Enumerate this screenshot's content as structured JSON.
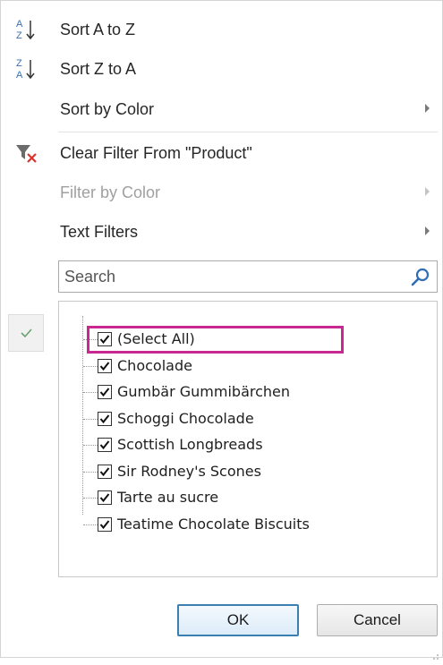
{
  "menu": {
    "sort_az": {
      "label": "Sort A to Z",
      "icon": "sort-ascending-icon"
    },
    "sort_za": {
      "label": "Sort Z to A",
      "icon": "sort-descending-icon"
    },
    "sort_by_color": {
      "label": "Sort by Color"
    },
    "clear_filter": {
      "label": "Clear Filter From \"Product\"",
      "icon": "clear-filter-icon"
    },
    "filter_by_color": {
      "label": "Filter by Color",
      "disabled": true
    },
    "text_filters": {
      "label": "Text Filters"
    }
  },
  "search": {
    "placeholder": "Search",
    "value": ""
  },
  "list": {
    "items": [
      {
        "label": "(Select All)",
        "checked": true
      },
      {
        "label": "Chocolade",
        "checked": true
      },
      {
        "label": "Gumbär Gummibärchen",
        "checked": true
      },
      {
        "label": "Schoggi Chocolade",
        "checked": true
      },
      {
        "label": "Scottish Longbreads",
        "checked": true
      },
      {
        "label": "Sir Rodney's Scones",
        "checked": true
      },
      {
        "label": "Tarte au sucre",
        "checked": true
      },
      {
        "label": "Teatime Chocolate Biscuits",
        "checked": true
      }
    ]
  },
  "buttons": {
    "ok": "OK",
    "cancel": "Cancel"
  },
  "colors": {
    "highlight": "#c8288f",
    "ok_border": "#3c7fb1",
    "clear_filter_x": "#d9342b",
    "check_gutter": "#6aa36f"
  }
}
